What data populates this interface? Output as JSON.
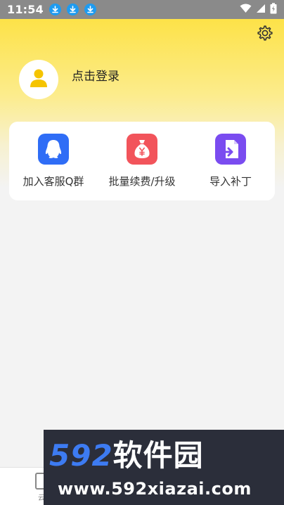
{
  "status_bar": {
    "time": "11:54",
    "battery_icon": "battery-charging-icon",
    "signal_icon": "cell-signal-icon",
    "wifi_icon": "wifi-icon",
    "notification_icons": [
      "download-icon",
      "download-icon",
      "download-icon"
    ]
  },
  "header": {
    "settings_icon": "gear-icon",
    "avatar_icon": "user-icon",
    "login_label": "点击登录"
  },
  "actions": [
    {
      "label": "加入客服Q群",
      "icon": "qq-penguin-icon",
      "color": "#2f6df6"
    },
    {
      "label": "批量续费/升级",
      "icon": "money-bag-icon",
      "color": "#f2545b"
    },
    {
      "label": "导入补丁",
      "icon": "import-document-icon",
      "color": "#7a4cf0"
    }
  ],
  "bottom_nav": {
    "cloud_label": "云"
  },
  "watermark": {
    "logo_number": "592",
    "logo_text": "软件园",
    "url": "www.592xiazai.com"
  },
  "colors": {
    "accent_yellow": "#fde248",
    "status_bar": "#8a8a8a",
    "download_badge": "#1e9bf0",
    "avatar_fill": "#f5c400"
  }
}
